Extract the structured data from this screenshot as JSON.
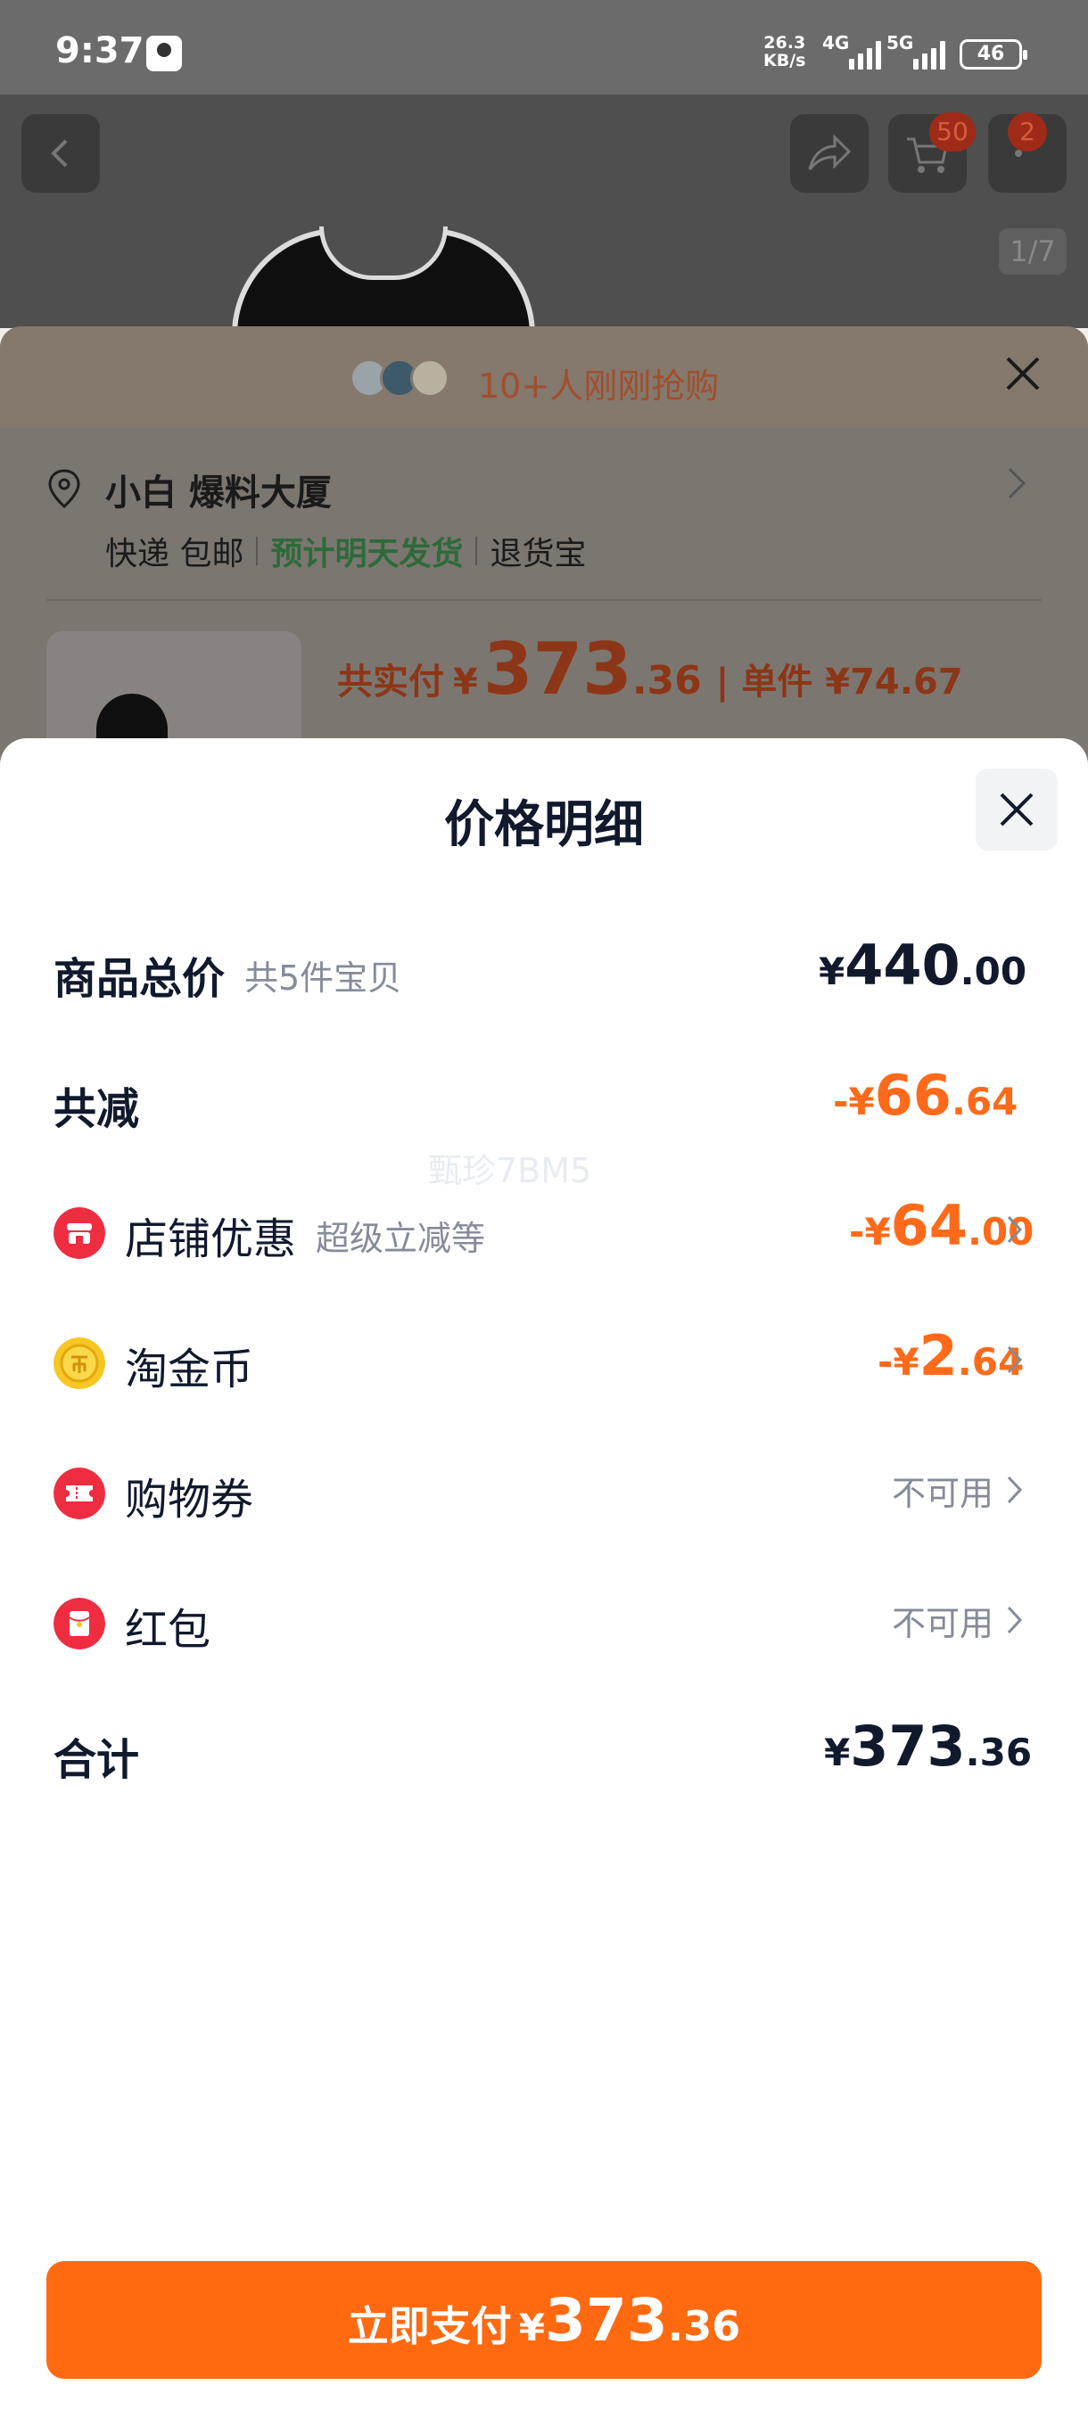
{
  "status_bar": {
    "time": "9:37",
    "net_speed_value": "26.3",
    "net_speed_unit": "KB/s",
    "network_1": "4G",
    "network_2": "5G",
    "battery": "46"
  },
  "product_page": {
    "cart_count": "50",
    "more_count": "2",
    "image_counter": "1/7"
  },
  "order_sheet": {
    "headline": "10+人刚刚抢购",
    "address_name": "小白 爆料大厦",
    "shipping": {
      "delivery": "快递 包邮",
      "estimate": "预计明天发货",
      "return": "退货宝"
    },
    "pay_label": "共实付",
    "pay_yen": "¥",
    "pay_int": "373",
    "pay_dec": ".36",
    "unit_price": "| 单件 ¥74.67"
  },
  "price_detail": {
    "title": "价格明细",
    "watermark": "甄珍7BM5",
    "items_total": {
      "label": "商品总价",
      "sub": "共5件宝贝",
      "yen": "¥",
      "int": "440",
      "dec": ".00"
    },
    "total_reduction": {
      "label": "共减",
      "yen": "-¥",
      "int": "66",
      "dec": ".64"
    },
    "store_discount": {
      "icon": "store-icon",
      "label": "店铺优惠",
      "sub": "超级立减等",
      "yen": "-¥",
      "int": "64",
      "dec": ".00"
    },
    "gold_coin": {
      "icon": "gold-coin-icon",
      "label": "淘金币",
      "yen": "-¥",
      "int": "2",
      "dec": ".64"
    },
    "shopping_coupon": {
      "icon": "coupon-icon",
      "label": "购物券",
      "status": "不可用"
    },
    "red_packet": {
      "icon": "red-packet-icon",
      "label": "红包",
      "status": "不可用"
    },
    "total": {
      "label": "合计",
      "yen": "¥",
      "int": "373",
      "dec": ".36"
    }
  },
  "pay_button": {
    "label": "立即支付",
    "yen": "¥",
    "int": "373",
    "dec": ".36"
  },
  "colors": {
    "accent_orange": "#ff6a10",
    "discount_orange": "#ff6a1a",
    "text_dark": "#11192d",
    "text_muted": "#858b98",
    "icon_red": "#ee2e40",
    "coin_gold": "#f6c623"
  }
}
